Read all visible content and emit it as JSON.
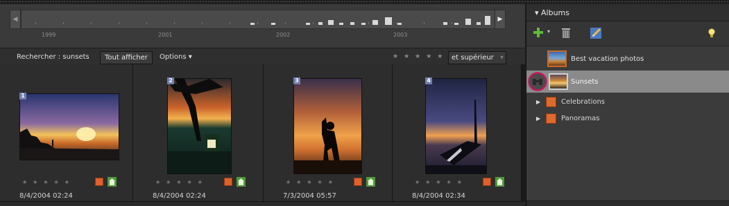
{
  "timeline": {
    "years": [
      "1999",
      "2001",
      "2002",
      "2003"
    ]
  },
  "searchbar": {
    "search_label": "Rechercher : sunsets",
    "show_all": "Tout afficher",
    "options": "Options ▾",
    "rating_stars": "★★★★★",
    "rating_mode": "et supérieur"
  },
  "photos": [
    {
      "number": "1",
      "date": "8/4/2004 02:24",
      "stars": "★★★★★"
    },
    {
      "number": "2",
      "date": "8/4/2004 02:24",
      "stars": "★★★★★"
    },
    {
      "number": "3",
      "date": "7/3/2004 05:57",
      "stars": "★★★★★"
    },
    {
      "number": "4",
      "date": "8/4/2004 02:34",
      "stars": "★★★★★"
    }
  ],
  "albums_panel": {
    "title": "▾ Albums",
    "albums": [
      {
        "label": "Best vacation photos"
      },
      {
        "label": "Sunsets"
      }
    ],
    "categories": [
      {
        "label": "Celebrations"
      },
      {
        "label": "Panoramas"
      }
    ]
  },
  "colors": {
    "accent_orange": "#e0612a",
    "selection_gray": "#8a8a8a",
    "highlight_ring": "#c2185b"
  },
  "icons": [
    "chevron-left-icon",
    "chevron-right-icon",
    "add-icon",
    "trash-icon",
    "edit-icon",
    "lightbulb-icon",
    "binoculars-icon",
    "collection-icon"
  ]
}
